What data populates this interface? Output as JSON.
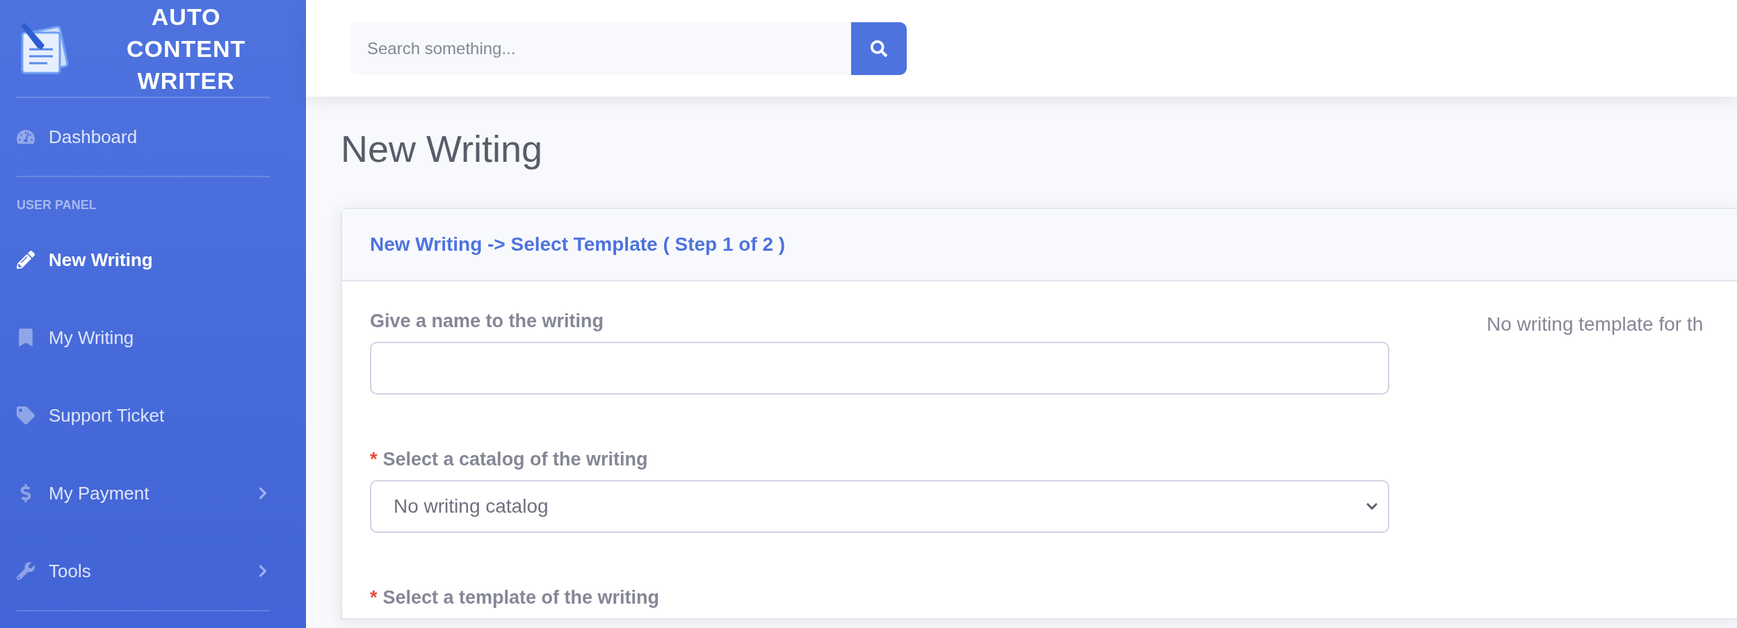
{
  "brand": {
    "name": "AUTO CONTENT WRITER"
  },
  "sidebar": {
    "items": [
      {
        "kind": "divider"
      },
      {
        "kind": "link",
        "label": "Dashboard",
        "selected": false,
        "expandable": false
      },
      {
        "kind": "divider"
      },
      {
        "kind": "heading",
        "label": "USER PANEL"
      },
      {
        "kind": "link",
        "label": "New Writing",
        "selected": true,
        "expandable": false
      },
      {
        "kind": "link",
        "label": "My Writing",
        "selected": false,
        "expandable": false
      },
      {
        "kind": "link",
        "label": "Support Ticket",
        "selected": false,
        "expandable": false
      },
      {
        "kind": "link",
        "label": "My Payment",
        "selected": false,
        "expandable": true
      },
      {
        "kind": "link",
        "label": "Tools",
        "selected": false,
        "expandable": true
      },
      {
        "kind": "divider"
      }
    ]
  },
  "search": {
    "placeholder": "Search something..."
  },
  "page_title": "New Writing",
  "card": {
    "title": "New Writing -> Select Template ( Step 1 of 2 )",
    "fields": [
      {
        "kind": "text",
        "label": "Give a name to the writing",
        "required": false
      },
      {
        "kind": "select",
        "label": "Select a catalog of the writing",
        "required": true,
        "value": "No writing catalog"
      },
      {
        "kind": "label",
        "label": "Select a template of the writing",
        "required": true
      }
    ],
    "side_note": "No writing template for th",
    "required_mark": "*"
  }
}
